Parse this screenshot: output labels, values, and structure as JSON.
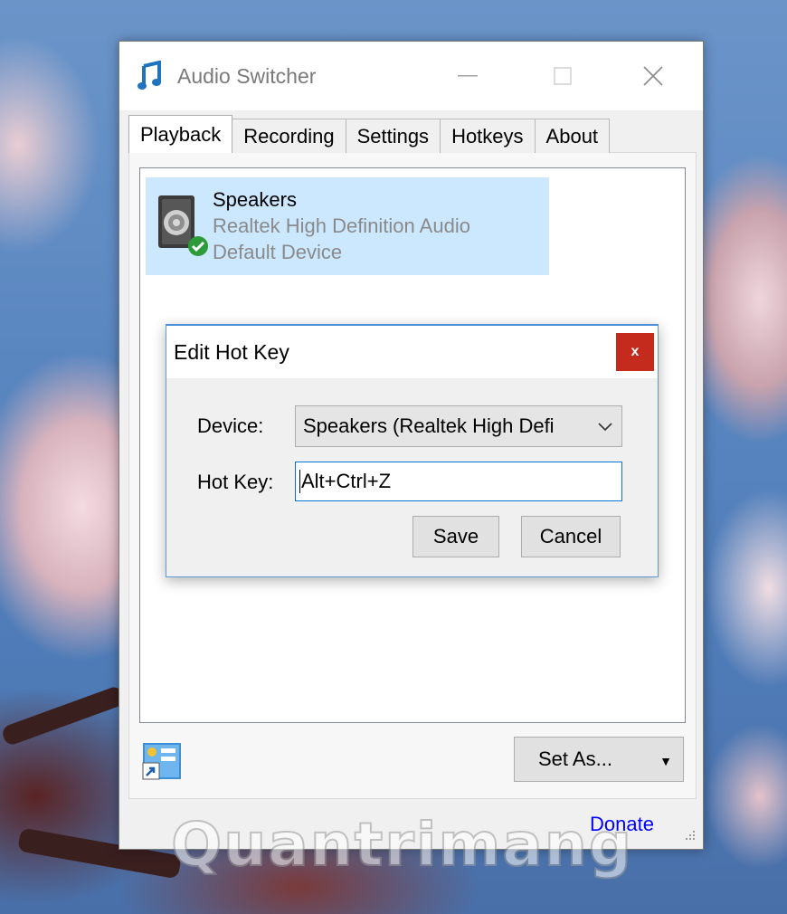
{
  "window": {
    "title": "Audio Switcher"
  },
  "tabs": [
    {
      "label": "Playback",
      "active": true
    },
    {
      "label": "Recording",
      "active": false
    },
    {
      "label": "Settings",
      "active": false
    },
    {
      "label": "Hotkeys",
      "active": false
    },
    {
      "label": "About",
      "active": false
    }
  ],
  "device": {
    "name": "Speakers",
    "driver": "Realtek High Definition Audio",
    "status": "Default Device",
    "icon": "speaker-icon",
    "badge_icon": "checkmark-icon"
  },
  "dialog": {
    "title": "Edit Hot Key",
    "close_label": "x",
    "device_label": "Device:",
    "device_value": "Speakers (Realtek High Defi",
    "hotkey_label": "Hot Key:",
    "hotkey_value": "Alt+Ctrl+Z",
    "save_label": "Save",
    "cancel_label": "Cancel"
  },
  "footer": {
    "set_as_label": "Set As...",
    "donate_label": "Donate"
  },
  "watermark": {
    "text": "Quantrimang"
  },
  "colors": {
    "selection": "#cce8ff",
    "close_red": "#c42b1c",
    "link_blue": "#0000ff",
    "accent_blue": "#0078d7"
  }
}
